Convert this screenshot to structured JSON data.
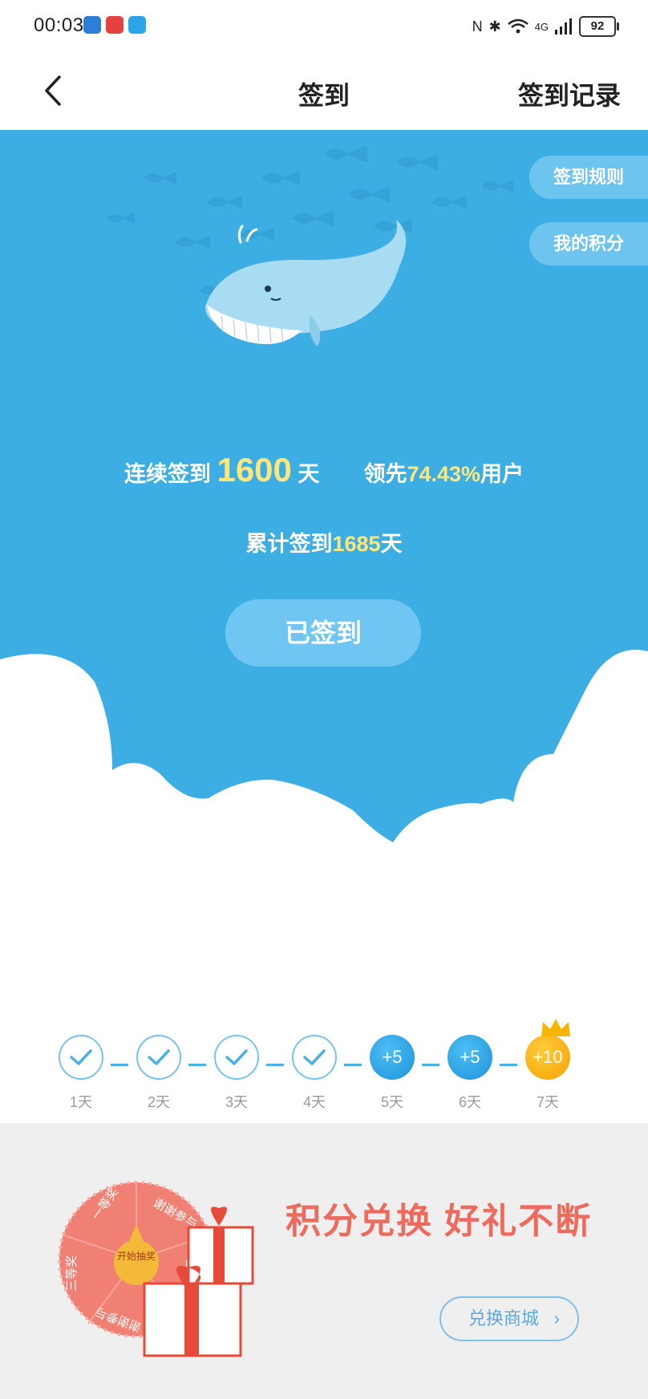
{
  "status_bar": {
    "time": "00:03",
    "battery": "92",
    "network": "4G"
  },
  "nav": {
    "title": "签到",
    "right_label": "签到记录"
  },
  "hero": {
    "rules_label": "签到规则",
    "points_label": "我的积分",
    "streak_prefix": "连续签到",
    "streak_days": "1600",
    "streak_suffix": "天",
    "lead_prefix": "领先",
    "lead_pct": "74.43%",
    "lead_suffix": "用户",
    "total_prefix": "累计签到",
    "total_days": "1685",
    "total_suffix": "天",
    "signed_label": "已签到"
  },
  "progress": {
    "days": [
      {
        "label": "1天",
        "state": "checked",
        "reward": ""
      },
      {
        "label": "2天",
        "state": "checked",
        "reward": ""
      },
      {
        "label": "3天",
        "state": "checked",
        "reward": ""
      },
      {
        "label": "4天",
        "state": "checked",
        "reward": ""
      },
      {
        "label": "5天",
        "state": "reward",
        "reward": "+5"
      },
      {
        "label": "6天",
        "state": "reward",
        "reward": "+5"
      },
      {
        "label": "7天",
        "state": "bonus",
        "reward": "+10"
      }
    ]
  },
  "banner": {
    "title": "积分兑换 好礼不断",
    "mall_button": "兑换商城",
    "wheel_center": "开始抽奖",
    "wheel_segments": [
      "一等奖",
      "谢谢参与",
      "二等奖",
      "三等奖",
      "谢谢参与"
    ]
  },
  "colors": {
    "sky": "#3caee4",
    "gold": "#ffe67a",
    "accent_red": "#ee6a5c",
    "progress_blue": "#1e94d8",
    "progress_gold": "#f5a300"
  }
}
